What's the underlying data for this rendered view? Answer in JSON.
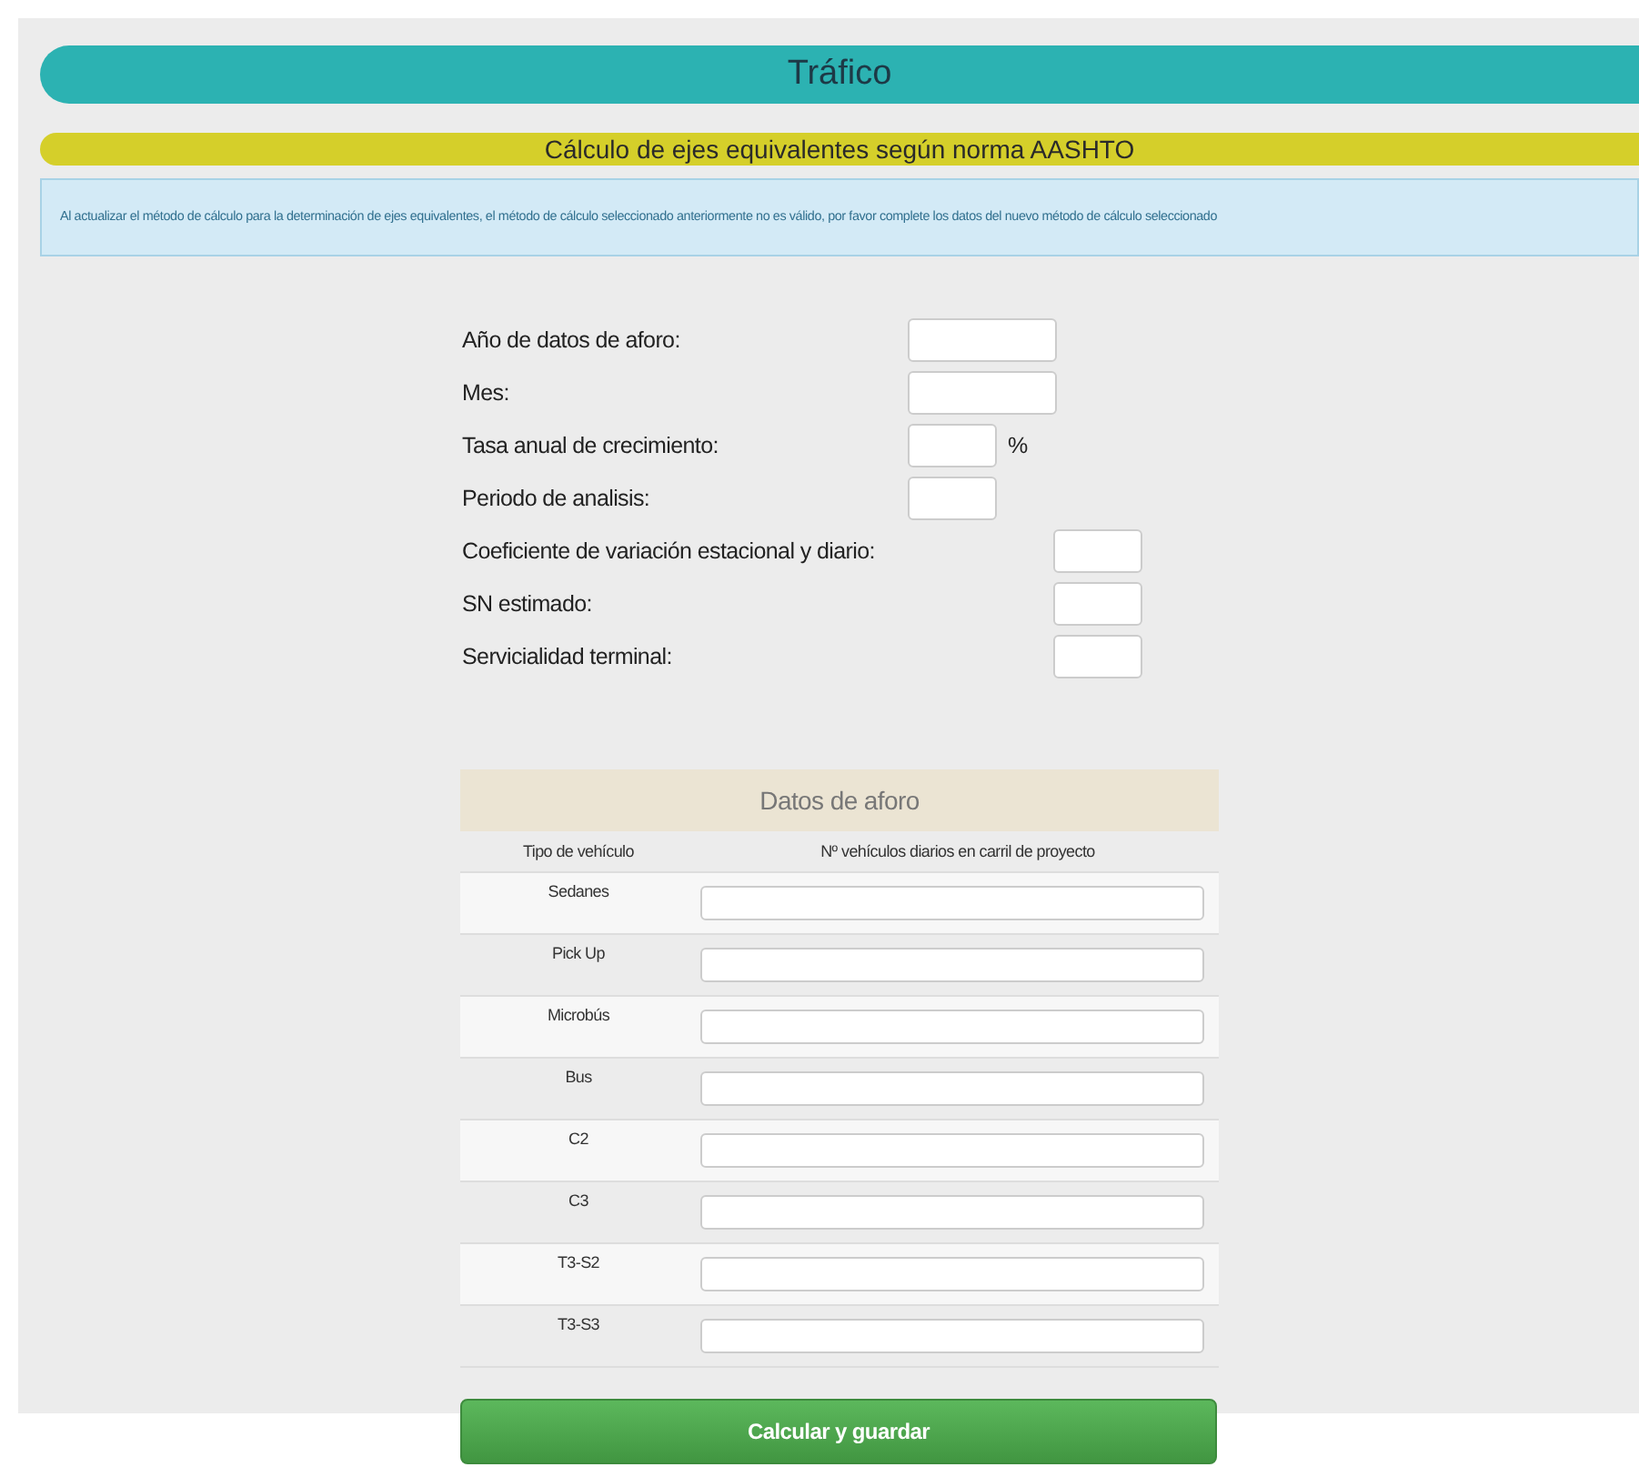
{
  "title": "Tráfico",
  "subtitle": "Cálculo de ejes equivalentes según norma AASHTO",
  "notice": "Al actualizar el método de cálculo para la determinación de ejes equivalentes, el método de cálculo seleccionado anteriormente no es válido, por favor complete los datos del nuevo método de cálculo seleccionado",
  "field_groups": [
    {
      "fields": [
        {
          "label": "Año de datos de aforo:",
          "kind": "wide"
        },
        {
          "label": "Mes:",
          "kind": "wide"
        },
        {
          "label": "Tasa anual de crecimiento:",
          "kind": "narrow",
          "unit": "%"
        },
        {
          "label": "Periodo de analisis:",
          "kind": "narrow"
        }
      ]
    },
    {
      "fields": [
        {
          "label": "Coeficiente de variación estacional y diario:",
          "kind": "narrow"
        },
        {
          "label": "SN estimado:",
          "kind": "narrow"
        },
        {
          "label": "Servicialidad terminal:",
          "kind": "narrow"
        }
      ]
    }
  ],
  "table": {
    "title": "Datos de aforo",
    "columns": [
      "Tipo de vehículo",
      "Nº vehículos diarios en carril de proyecto"
    ],
    "rows": [
      "Sedanes",
      "Pick Up",
      "Microbús",
      "Bus",
      "C2",
      "C3",
      "T3-S2",
      "T3-S3"
    ]
  },
  "button": "Calcular y guardar"
}
